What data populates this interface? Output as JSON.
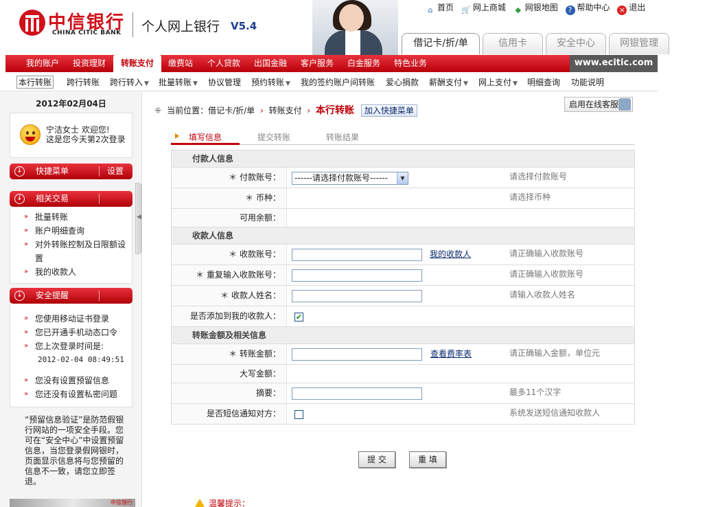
{
  "brand": {
    "name_cn": "中信银行",
    "name_en": "CHINA CITIC BANK",
    "app_title": "个人网上银行",
    "version": "V5.4",
    "accent": "#c0000a"
  },
  "top_links": [
    {
      "icon": "home-icon",
      "label": "首页"
    },
    {
      "icon": "cart-icon",
      "label": "网上商城"
    },
    {
      "icon": "sitemap-icon",
      "label": "网银地图"
    },
    {
      "icon": "help-icon",
      "label": "帮助中心"
    },
    {
      "icon": "logout-icon",
      "label": "退出"
    }
  ],
  "header_tabs": [
    "借记卡/折/单",
    "信用卡",
    "安全中心",
    "网银管理"
  ],
  "main_nav": [
    "我的账户",
    "投资理财",
    "转账支付",
    "缴费站",
    "个人贷款",
    "出国金融",
    "客户服务",
    "白金服务",
    "特色业务"
  ],
  "main_nav_active": "转账支付",
  "site_url": "www.ecitic.com",
  "sub_nav": [
    {
      "label": "本行转账",
      "dd": ""
    },
    {
      "label": "跨行转账",
      "dd": ""
    },
    {
      "label": "跨行转入",
      "dd": "▼"
    },
    {
      "label": "批量转账",
      "dd": "▼"
    },
    {
      "label": "协议管理",
      "dd": ""
    },
    {
      "label": "预约转账",
      "dd": "▼"
    },
    {
      "label": "我的签约账户间转账",
      "dd": ""
    },
    {
      "label": "爱心捐款",
      "dd": ""
    },
    {
      "label": "薪酬支付",
      "dd": "▼"
    },
    {
      "label": "网上支付",
      "dd": "▼"
    },
    {
      "label": "明细查询",
      "dd": ""
    },
    {
      "label": "功能说明",
      "dd": ""
    }
  ],
  "sidebar": {
    "date": "2012年02月04日",
    "welcome_line1": "宁洁女士 欢迎您!",
    "welcome_line2": "这是您今天第2次登录",
    "quick_menu": {
      "title": "快捷菜单",
      "settings": "设置"
    },
    "related": {
      "title": "相关交易",
      "items": [
        "批量转账",
        "账户明细查询",
        "对外转账控制及日限额设",
        "置",
        "我的收款人"
      ]
    },
    "security": {
      "title": "安全提醒",
      "items": [
        "您使用移动证书登录",
        "您已开通手机动态口令",
        "您上次登录时间是:",
        "2012-02-04 08:49:51",
        "您没有设置预留信息",
        "您还没有设置私密问题"
      ]
    },
    "note": "“预留信息验证”是防范假银行网站的一项安全手段。您可在“安全中心”中设置预留信息，当您登录假网银时，页面显示信息将与您预留的信息不一致，请您立即签退。",
    "banner_text": "中信银行"
  },
  "breadcrumb": {
    "prefix": "当前位置：借记卡/折/单",
    "mid": "转账支付",
    "current": "本行转账",
    "quick_add": "加入快捷菜单"
  },
  "online_service": "启用在线客服",
  "steps": [
    "填写信息",
    "提交转账",
    "转账结果"
  ],
  "form": {
    "payer_section": "付款人信息",
    "payer_account": {
      "label": "＊ 付款账号：",
      "select": "------请选择付款账号------",
      "hint": "请选择付款账号"
    },
    "currency": {
      "label": "＊ 币种：",
      "hint": "请选择币种"
    },
    "balance": {
      "label": "可用余额："
    },
    "payee_section": "收款人信息",
    "payee_account": {
      "label": "＊ 收款账号：",
      "link": "我的收款人",
      "hint": "请正确输入收款账号"
    },
    "payee_account_confirm": {
      "label": "＊ 重复输入收款账号：",
      "hint": "请正确输入收款账号"
    },
    "payee_name": {
      "label": "＊ 收款人姓名：",
      "hint": "请输入收款人姓名"
    },
    "add_payee": {
      "label": "是否添加到我的收款人：",
      "checked": true
    },
    "amount_section": "转账金额及相关信息",
    "amount": {
      "label": "＊ 转账金额：",
      "link": "查看费率表",
      "hint": "请正确输入金额，单位元"
    },
    "amount_words": {
      "label": "大写金额："
    },
    "memo": {
      "label": "摘要：",
      "hint": "最多11个汉字"
    },
    "sms_notify": {
      "label": "是否短信通知对方：",
      "checked": false,
      "hint": "系统发送短信通知收款人"
    }
  },
  "buttons": {
    "submit": "提 交",
    "reset": "重 填"
  },
  "tips_title": "温馨提示："
}
